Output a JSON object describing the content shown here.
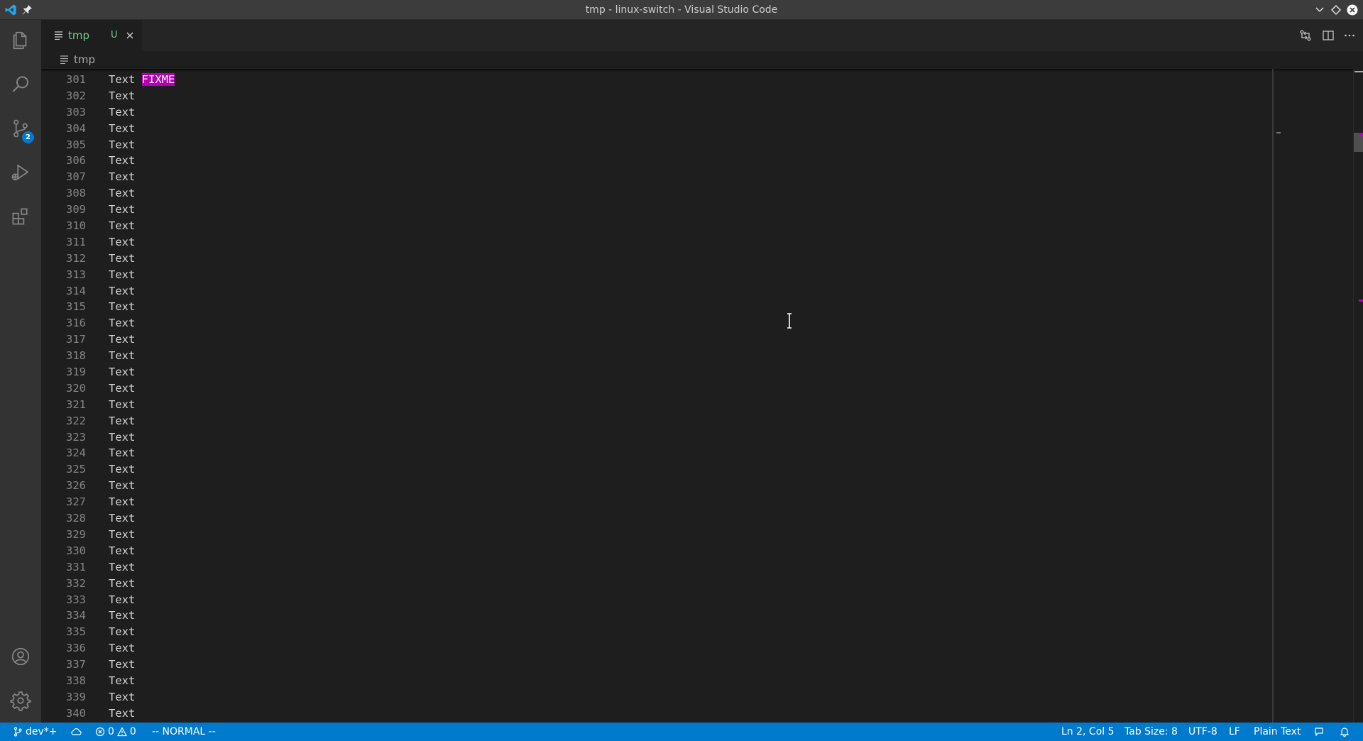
{
  "window": {
    "title": "tmp - linux-switch - Visual Studio Code"
  },
  "activity_bar": {
    "scm_badge": "2"
  },
  "tab": {
    "name": "tmp",
    "status": "U"
  },
  "breadcrumb": {
    "file": "tmp"
  },
  "editor": {
    "lines": [
      {
        "n": "301",
        "t": "Text",
        "mark": "FIXME"
      },
      {
        "n": "302",
        "t": "Text"
      },
      {
        "n": "303",
        "t": "Text"
      },
      {
        "n": "304",
        "t": "Text"
      },
      {
        "n": "305",
        "t": "Text"
      },
      {
        "n": "306",
        "t": "Text"
      },
      {
        "n": "307",
        "t": "Text"
      },
      {
        "n": "308",
        "t": "Text"
      },
      {
        "n": "309",
        "t": "Text"
      },
      {
        "n": "310",
        "t": "Text"
      },
      {
        "n": "311",
        "t": "Text"
      },
      {
        "n": "312",
        "t": "Text"
      },
      {
        "n": "313",
        "t": "Text"
      },
      {
        "n": "314",
        "t": "Text"
      },
      {
        "n": "315",
        "t": "Text"
      },
      {
        "n": "316",
        "t": "Text"
      },
      {
        "n": "317",
        "t": "Text"
      },
      {
        "n": "318",
        "t": "Text"
      },
      {
        "n": "319",
        "t": "Text"
      },
      {
        "n": "320",
        "t": "Text"
      },
      {
        "n": "321",
        "t": "Text"
      },
      {
        "n": "322",
        "t": "Text"
      },
      {
        "n": "323",
        "t": "Text"
      },
      {
        "n": "324",
        "t": "Text"
      },
      {
        "n": "325",
        "t": "Text"
      },
      {
        "n": "326",
        "t": "Text"
      },
      {
        "n": "327",
        "t": "Text"
      },
      {
        "n": "328",
        "t": "Text"
      },
      {
        "n": "329",
        "t": "Text"
      },
      {
        "n": "330",
        "t": "Text"
      },
      {
        "n": "331",
        "t": "Text"
      },
      {
        "n": "332",
        "t": "Text"
      },
      {
        "n": "333",
        "t": "Text"
      },
      {
        "n": "334",
        "t": "Text"
      },
      {
        "n": "335",
        "t": "Text"
      },
      {
        "n": "336",
        "t": "Text"
      },
      {
        "n": "337",
        "t": "Text"
      },
      {
        "n": "338",
        "t": "Text"
      },
      {
        "n": "339",
        "t": "Text"
      },
      {
        "n": "340",
        "t": "Text"
      }
    ]
  },
  "status_bar": {
    "branch": "dev*+",
    "errors": "0",
    "warnings": "0",
    "mode": "-- NORMAL --",
    "position": "Ln 2, Col 5",
    "tab_size": "Tab Size: 8",
    "encoding": "UTF-8",
    "eol": "LF",
    "language": "Plain Text"
  },
  "colors": {
    "accent": "#007acc",
    "highlight": "#b200b2",
    "untracked": "#73c991"
  }
}
